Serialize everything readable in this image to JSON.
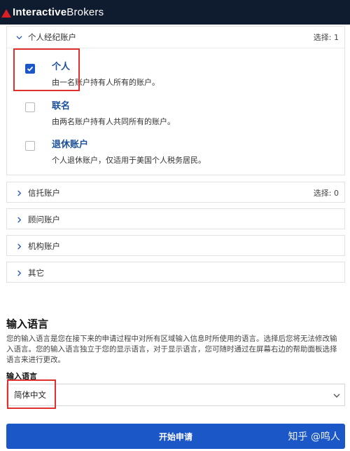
{
  "brand": {
    "name_bold": "Interactive",
    "name_light": "Brokers",
    "accent": "#d81f26"
  },
  "panels": {
    "individual": {
      "title": "个人经纪账户",
      "count": "选择: 1",
      "options": [
        {
          "title": "个人",
          "desc": "由一名账户持有人所有的账户。",
          "checked": true
        },
        {
          "title": "联名",
          "desc": "由两名账户持有人共同所有的账户。",
          "checked": false
        },
        {
          "title": "退休账户",
          "desc": "个人退休账户，仅适用于美国个人税务居民。",
          "checked": false
        }
      ]
    },
    "trust": {
      "title": "信托账户",
      "count": "选择: 0"
    },
    "advisor": {
      "title": "顾问账户"
    },
    "institution": {
      "title": "机构账户"
    },
    "other": {
      "title": "其它"
    }
  },
  "language": {
    "title": "输入语言",
    "desc": "您的输入语言是您在接下来的申请过程中对所有区域输入信息时所使用的语言。选择后您将无法修改输入语言。您的输入语言独立于您的显示语言，对于显示语言，您可随时通过在屏幕右边的帮助面板选择语言来进行更改。",
    "field_label": "输入语言",
    "selected": "简体中文"
  },
  "submit_label": "开始申请",
  "watermark": "知乎 @鸣人",
  "colors": {
    "primary": "#1c57c8",
    "topbar": "#0f1b2e",
    "highlight": "#e0302a"
  }
}
